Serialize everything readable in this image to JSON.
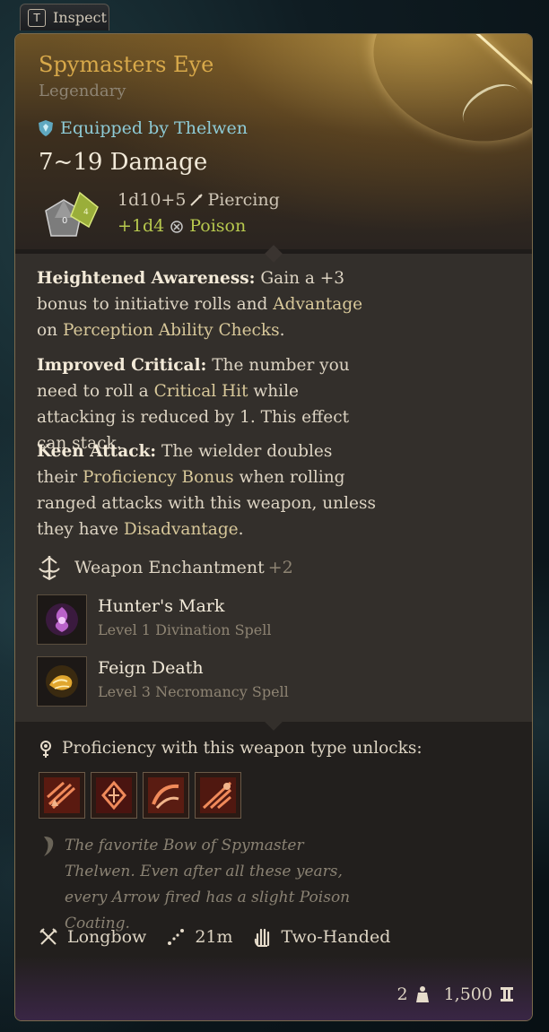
{
  "inspect_tab": {
    "key": "T",
    "label": "Inspect"
  },
  "item": {
    "name": "Spymasters Eye",
    "rarity": "Legendary",
    "equipped": "Equipped by Thelwen",
    "damage": "7~19 Damage",
    "damage_main": {
      "dice": "1d10+5",
      "type": "Piercing"
    },
    "damage_bonus": {
      "dice": "+1d4",
      "type": "Poison"
    }
  },
  "descriptions": [
    {
      "term": "Heightened Awareness:",
      "segments": [
        " Gain a +3 bonus to initiative rolls and ",
        "Advantage",
        " on ",
        "Perception Ability Checks",
        "."
      ]
    },
    {
      "term": "Improved Critical:",
      "segments": [
        " The number you need to roll a ",
        "Critical Hit",
        " while attacking is reduced by 1. This effect can stack."
      ]
    },
    {
      "term": "Keen Attack:",
      "segments": [
        " The wielder doubles their ",
        "Proficiency Bonus",
        " when rolling ranged attacks with this weapon, unless they have ",
        "Disadvantage",
        "."
      ]
    }
  ],
  "enchantment": {
    "label": "Weapon Enchantment",
    "bonus": "+2"
  },
  "spells": [
    {
      "name": "Hunter's Mark",
      "sub": "Level 1 Divination Spell",
      "icon": "hunters-mark-icon"
    },
    {
      "name": "Feign Death",
      "sub": "Level 3 Necromancy Spell",
      "icon": "feign-death-icon"
    }
  ],
  "proficiency": {
    "label": "Proficiency with this weapon type unlocks:"
  },
  "flavor": "The favorite Bow of Spymaster Thelwen. Even after all these years, every Arrow fired has a slight Poison Coating.",
  "properties": [
    {
      "label": "Longbow",
      "icon": "longbow-icon"
    },
    {
      "label": "21m",
      "icon": "range-icon"
    },
    {
      "label": "Two-Handed",
      "icon": "two-handed-icon"
    }
  ],
  "footer": {
    "weight": "2",
    "value": "1,500"
  },
  "colors": {
    "name": "#d8a94a",
    "equipped": "#8ecbd6",
    "poison": "#b7c84e",
    "link": "#d8c89a"
  }
}
